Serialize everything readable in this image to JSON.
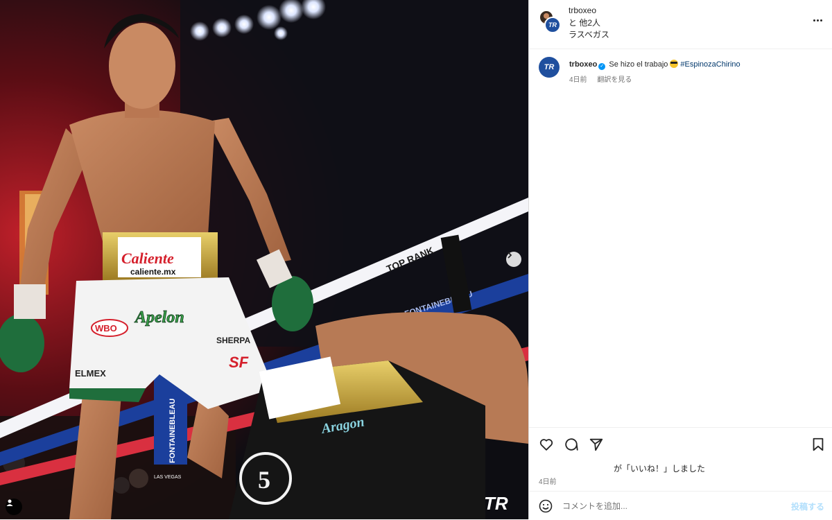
{
  "header": {
    "username": "trboxeo",
    "others": "と 他2人",
    "location": "ラスベガス"
  },
  "caption": {
    "avatar_initials": "TR",
    "username": "trboxeo",
    "text": "Se hizo el trabajo",
    "hashtag": "#EspinozaChirino",
    "time": "4日前",
    "translate": "翻訳を見る"
  },
  "photo": {
    "waistband_brand": "Caliente",
    "waistband_site": "caliente.mx",
    "trunk_patch": "Apelon",
    "sponsor_wbo": "WBO",
    "sponsor_sherpa": "SHERPA",
    "sponsor_elmex": "ELMEX",
    "sponsor_sf": "SF",
    "rope_top_rank": "TOP RANK",
    "rope_fontainebleau": "FONTAINEBLEAU",
    "turnbuckle_text": "FONTAINEBLEAU",
    "turnbuckle_sub": "LAS VEGAS",
    "opponent_trunk_text": "Aragon",
    "opponent_trunk_number": "5",
    "watermark": "TR"
  },
  "likes": {
    "text": "が「いいね！」しました"
  },
  "post_date": "4日前",
  "comment": {
    "placeholder": "コメントを追加...",
    "post_label": "投稿する"
  },
  "icons": {
    "like": "heart-icon",
    "comment": "comment-icon",
    "share": "send-icon",
    "save": "bookmark-icon",
    "emoji": "smiley-icon",
    "more": "more-options-icon",
    "next": "chevron-right-icon",
    "tags": "user-tag-icon"
  },
  "colors": {
    "verified": "#0095f6",
    "hashtag": "#00376b",
    "brand_blue": "#1f4f9e",
    "post_button": "#b2dffc"
  }
}
